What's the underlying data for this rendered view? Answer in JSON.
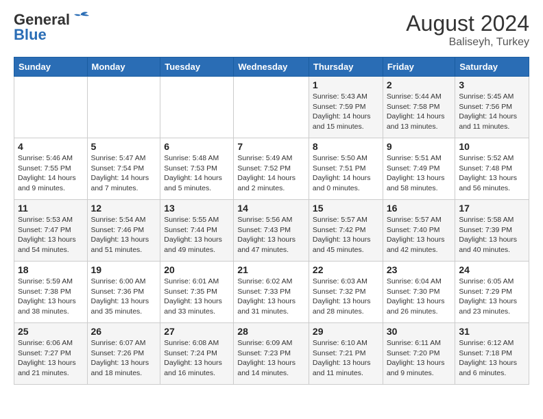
{
  "header": {
    "logo_general": "General",
    "logo_blue": "Blue",
    "month_year": "August 2024",
    "location": "Baliseyh, Turkey"
  },
  "days_of_week": [
    "Sunday",
    "Monday",
    "Tuesday",
    "Wednesday",
    "Thursday",
    "Friday",
    "Saturday"
  ],
  "weeks": [
    [
      {
        "day": "",
        "info": ""
      },
      {
        "day": "",
        "info": ""
      },
      {
        "day": "",
        "info": ""
      },
      {
        "day": "",
        "info": ""
      },
      {
        "day": "1",
        "info": "Sunrise: 5:43 AM\nSunset: 7:59 PM\nDaylight: 14 hours\nand 15 minutes."
      },
      {
        "day": "2",
        "info": "Sunrise: 5:44 AM\nSunset: 7:58 PM\nDaylight: 14 hours\nand 13 minutes."
      },
      {
        "day": "3",
        "info": "Sunrise: 5:45 AM\nSunset: 7:56 PM\nDaylight: 14 hours\nand 11 minutes."
      }
    ],
    [
      {
        "day": "4",
        "info": "Sunrise: 5:46 AM\nSunset: 7:55 PM\nDaylight: 14 hours\nand 9 minutes."
      },
      {
        "day": "5",
        "info": "Sunrise: 5:47 AM\nSunset: 7:54 PM\nDaylight: 14 hours\nand 7 minutes."
      },
      {
        "day": "6",
        "info": "Sunrise: 5:48 AM\nSunset: 7:53 PM\nDaylight: 14 hours\nand 5 minutes."
      },
      {
        "day": "7",
        "info": "Sunrise: 5:49 AM\nSunset: 7:52 PM\nDaylight: 14 hours\nand 2 minutes."
      },
      {
        "day": "8",
        "info": "Sunrise: 5:50 AM\nSunset: 7:51 PM\nDaylight: 14 hours\nand 0 minutes."
      },
      {
        "day": "9",
        "info": "Sunrise: 5:51 AM\nSunset: 7:49 PM\nDaylight: 13 hours\nand 58 minutes."
      },
      {
        "day": "10",
        "info": "Sunrise: 5:52 AM\nSunset: 7:48 PM\nDaylight: 13 hours\nand 56 minutes."
      }
    ],
    [
      {
        "day": "11",
        "info": "Sunrise: 5:53 AM\nSunset: 7:47 PM\nDaylight: 13 hours\nand 54 minutes."
      },
      {
        "day": "12",
        "info": "Sunrise: 5:54 AM\nSunset: 7:46 PM\nDaylight: 13 hours\nand 51 minutes."
      },
      {
        "day": "13",
        "info": "Sunrise: 5:55 AM\nSunset: 7:44 PM\nDaylight: 13 hours\nand 49 minutes."
      },
      {
        "day": "14",
        "info": "Sunrise: 5:56 AM\nSunset: 7:43 PM\nDaylight: 13 hours\nand 47 minutes."
      },
      {
        "day": "15",
        "info": "Sunrise: 5:57 AM\nSunset: 7:42 PM\nDaylight: 13 hours\nand 45 minutes."
      },
      {
        "day": "16",
        "info": "Sunrise: 5:57 AM\nSunset: 7:40 PM\nDaylight: 13 hours\nand 42 minutes."
      },
      {
        "day": "17",
        "info": "Sunrise: 5:58 AM\nSunset: 7:39 PM\nDaylight: 13 hours\nand 40 minutes."
      }
    ],
    [
      {
        "day": "18",
        "info": "Sunrise: 5:59 AM\nSunset: 7:38 PM\nDaylight: 13 hours\nand 38 minutes."
      },
      {
        "day": "19",
        "info": "Sunrise: 6:00 AM\nSunset: 7:36 PM\nDaylight: 13 hours\nand 35 minutes."
      },
      {
        "day": "20",
        "info": "Sunrise: 6:01 AM\nSunset: 7:35 PM\nDaylight: 13 hours\nand 33 minutes."
      },
      {
        "day": "21",
        "info": "Sunrise: 6:02 AM\nSunset: 7:33 PM\nDaylight: 13 hours\nand 31 minutes."
      },
      {
        "day": "22",
        "info": "Sunrise: 6:03 AM\nSunset: 7:32 PM\nDaylight: 13 hours\nand 28 minutes."
      },
      {
        "day": "23",
        "info": "Sunrise: 6:04 AM\nSunset: 7:30 PM\nDaylight: 13 hours\nand 26 minutes."
      },
      {
        "day": "24",
        "info": "Sunrise: 6:05 AM\nSunset: 7:29 PM\nDaylight: 13 hours\nand 23 minutes."
      }
    ],
    [
      {
        "day": "25",
        "info": "Sunrise: 6:06 AM\nSunset: 7:27 PM\nDaylight: 13 hours\nand 21 minutes."
      },
      {
        "day": "26",
        "info": "Sunrise: 6:07 AM\nSunset: 7:26 PM\nDaylight: 13 hours\nand 18 minutes."
      },
      {
        "day": "27",
        "info": "Sunrise: 6:08 AM\nSunset: 7:24 PM\nDaylight: 13 hours\nand 16 minutes."
      },
      {
        "day": "28",
        "info": "Sunrise: 6:09 AM\nSunset: 7:23 PM\nDaylight: 13 hours\nand 14 minutes."
      },
      {
        "day": "29",
        "info": "Sunrise: 6:10 AM\nSunset: 7:21 PM\nDaylight: 13 hours\nand 11 minutes."
      },
      {
        "day": "30",
        "info": "Sunrise: 6:11 AM\nSunset: 7:20 PM\nDaylight: 13 hours\nand 9 minutes."
      },
      {
        "day": "31",
        "info": "Sunrise: 6:12 AM\nSunset: 7:18 PM\nDaylight: 13 hours\nand 6 minutes."
      }
    ]
  ]
}
